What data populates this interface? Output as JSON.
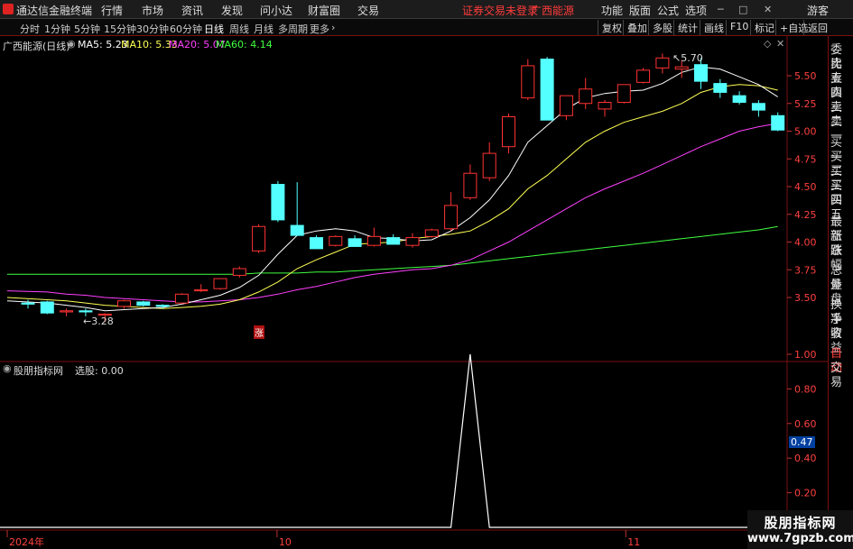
{
  "app": {
    "name": "通达信金融终端"
  },
  "menu": [
    "行情",
    "市场",
    "资讯",
    "发现",
    "问小达",
    "财富圈",
    "交易"
  ],
  "status_text": "证券交易未登录",
  "stock_name": "广西能源",
  "right_menu": [
    "功能",
    "版面",
    "公式",
    "选项"
  ],
  "window_buttons": [
    "─",
    "□",
    "✕"
  ],
  "user": "游客",
  "periods": [
    "分时",
    "1分钟",
    "5分钟",
    "15分钟",
    "30分钟",
    "60分钟",
    "日线",
    "周线",
    "月线",
    "多周期",
    "更多"
  ],
  "active_period": "日线",
  "toolbar": [
    "复权",
    "叠加",
    "多股",
    "统计",
    "画线",
    "F10",
    "标记",
    "+自选",
    "返回"
  ],
  "main_header": {
    "title": "广西能源(日线)"
  },
  "ma_legend": [
    {
      "label": "MA5: 5.23",
      "color": "#ffffff"
    },
    {
      "label": "MA10: 5.33",
      "color": "#ffff55"
    },
    {
      "label": "MA20: 5.07",
      "color": "#ff40ff"
    },
    {
      "label": "MA60: 4.14",
      "color": "#40ff40"
    }
  ],
  "price_axis": [
    "5.50",
    "5.25",
    "5.00",
    "4.75",
    "4.50",
    "4.25",
    "4.00",
    "3.75",
    "3.50"
  ],
  "annotations": {
    "high": "5.70",
    "low": "3.28",
    "limit_up": "涨"
  },
  "sub_header": {
    "title": "股朋指标网",
    "value_label": "选股: 0.00"
  },
  "sub_axis": [
    "1.00",
    "0.80",
    "0.60",
    "0.40",
    "0.20"
  ],
  "sub_current": "0.47",
  "date_axis": [
    "2024年",
    "10",
    "11"
  ],
  "right_panel": [
    "委比",
    "卖五",
    "卖四",
    "卖三",
    "卖二",
    "卖一",
    "买一",
    "买二",
    "买三",
    "买四",
    "买五",
    "最新",
    "涨跌",
    "涨幅",
    "总量",
    "外盘",
    "换手",
    "净资",
    "收益",
    "自动",
    "交易"
  ],
  "watermark": {
    "line1": "股朋指标网",
    "line2": "www.7gpzb.com"
  },
  "colors": {
    "up": "#ff3232",
    "down": "#54ffff",
    "background": "#000000",
    "grid": "#7a1010"
  },
  "chart_data": {
    "type": "candlestick",
    "y_range": [
      3.3,
      5.75
    ],
    "candles": [
      {
        "o": 3.45,
        "h": 3.48,
        "l": 3.4,
        "c": 3.44
      },
      {
        "o": 3.46,
        "h": 3.47,
        "l": 3.35,
        "c": 3.36
      },
      {
        "o": 3.37,
        "h": 3.4,
        "l": 3.33,
        "c": 3.38
      },
      {
        "o": 3.38,
        "h": 3.4,
        "l": 3.33,
        "c": 3.37
      },
      {
        "o": 3.34,
        "h": 3.36,
        "l": 3.28,
        "c": 3.35
      },
      {
        "o": 3.42,
        "h": 3.48,
        "l": 3.4,
        "c": 3.47
      },
      {
        "o": 3.46,
        "h": 3.47,
        "l": 3.42,
        "c": 3.43
      },
      {
        "o": 3.43,
        "h": 3.44,
        "l": 3.4,
        "c": 3.42
      },
      {
        "o": 3.45,
        "h": 3.54,
        "l": 3.44,
        "c": 3.53
      },
      {
        "o": 3.56,
        "h": 3.62,
        "l": 3.55,
        "c": 3.57
      },
      {
        "o": 3.58,
        "h": 3.64,
        "l": 3.57,
        "c": 3.67
      },
      {
        "o": 3.7,
        "h": 3.78,
        "l": 3.68,
        "c": 3.76
      },
      {
        "o": 3.92,
        "h": 4.16,
        "l": 3.9,
        "c": 4.14
      },
      {
        "o": 4.52,
        "h": 4.55,
        "l": 4.18,
        "c": 4.2
      },
      {
        "o": 4.15,
        "h": 4.54,
        "l": 4.06,
        "c": 4.06
      },
      {
        "o": 4.04,
        "h": 4.06,
        "l": 3.98,
        "c": 3.94
      },
      {
        "o": 3.97,
        "h": 4.06,
        "l": 3.96,
        "c": 4.05
      },
      {
        "o": 4.03,
        "h": 4.06,
        "l": 3.97,
        "c": 3.96
      },
      {
        "o": 3.97,
        "h": 4.13,
        "l": 3.96,
        "c": 4.05
      },
      {
        "o": 4.04,
        "h": 4.07,
        "l": 3.99,
        "c": 3.98
      },
      {
        "o": 3.97,
        "h": 4.08,
        "l": 3.95,
        "c": 4.04
      },
      {
        "o": 4.05,
        "h": 4.12,
        "l": 4.04,
        "c": 4.11
      },
      {
        "o": 4.12,
        "h": 4.45,
        "l": 4.1,
        "c": 4.33
      },
      {
        "o": 4.4,
        "h": 4.7,
        "l": 4.38,
        "c": 4.62
      },
      {
        "o": 4.58,
        "h": 4.9,
        "l": 4.55,
        "c": 4.8
      },
      {
        "o": 4.86,
        "h": 5.16,
        "l": 4.8,
        "c": 5.13
      },
      {
        "o": 5.3,
        "h": 5.65,
        "l": 5.28,
        "c": 5.59
      },
      {
        "o": 5.65,
        "h": 5.67,
        "l": 5.1,
        "c": 5.1
      },
      {
        "o": 5.14,
        "h": 5.3,
        "l": 5.1,
        "c": 5.32
      },
      {
        "o": 5.25,
        "h": 5.48,
        "l": 5.2,
        "c": 5.38
      },
      {
        "o": 5.2,
        "h": 5.28,
        "l": 5.13,
        "c": 5.26
      },
      {
        "o": 5.26,
        "h": 5.42,
        "l": 5.25,
        "c": 5.42
      },
      {
        "o": 5.44,
        "h": 5.57,
        "l": 5.43,
        "c": 5.55
      },
      {
        "o": 5.57,
        "h": 5.7,
        "l": 5.52,
        "c": 5.66
      },
      {
        "o": 5.56,
        "h": 5.64,
        "l": 5.48,
        "c": 5.58
      },
      {
        "o": 5.6,
        "h": 5.66,
        "l": 5.38,
        "c": 5.45
      },
      {
        "o": 5.43,
        "h": 5.47,
        "l": 5.3,
        "c": 5.35
      },
      {
        "o": 5.32,
        "h": 5.36,
        "l": 5.24,
        "c": 5.26
      },
      {
        "o": 5.25,
        "h": 5.28,
        "l": 5.13,
        "c": 5.19
      },
      {
        "o": 5.14,
        "h": 5.17,
        "l": 5.0,
        "c": 5.01
      }
    ],
    "ma5": [
      3.47,
      3.45,
      3.43,
      3.41,
      3.38,
      3.39,
      3.4,
      3.41,
      3.44,
      3.48,
      3.52,
      3.59,
      3.7,
      3.89,
      4.06,
      4.1,
      4.12,
      4.1,
      4.04,
      4.03,
      4.01,
      4.02,
      4.1,
      4.22,
      4.38,
      4.6,
      4.9,
      5.05,
      5.2,
      5.3,
      5.34,
      5.36,
      5.37,
      5.43,
      5.53,
      5.58,
      5.56,
      5.49,
      5.42,
      5.31
    ],
    "ma10": [
      3.5,
      3.48,
      3.47,
      3.45,
      3.43,
      3.42,
      3.41,
      3.4,
      3.41,
      3.42,
      3.44,
      3.48,
      3.55,
      3.64,
      3.76,
      3.84,
      3.91,
      3.98,
      3.99,
      4.0,
      4.03,
      4.05,
      4.07,
      4.1,
      4.19,
      4.3,
      4.48,
      4.6,
      4.75,
      4.9,
      5.0,
      5.08,
      5.13,
      5.18,
      5.25,
      5.35,
      5.4,
      5.42,
      5.41,
      5.37
    ],
    "ma20": [
      3.56,
      3.55,
      3.53,
      3.52,
      3.5,
      3.49,
      3.48,
      3.47,
      3.46,
      3.46,
      3.47,
      3.48,
      3.5,
      3.53,
      3.57,
      3.6,
      3.64,
      3.68,
      3.71,
      3.73,
      3.75,
      3.76,
      3.79,
      3.84,
      3.92,
      4.0,
      4.1,
      4.2,
      4.3,
      4.4,
      4.48,
      4.55,
      4.62,
      4.7,
      4.78,
      4.86,
      4.93,
      5.0,
      5.04,
      5.07
    ],
    "ma60": [
      3.71,
      3.71,
      3.71,
      3.71,
      3.71,
      3.71,
      3.71,
      3.71,
      3.71,
      3.71,
      3.71,
      3.71,
      3.72,
      3.72,
      3.72,
      3.73,
      3.73,
      3.74,
      3.75,
      3.76,
      3.77,
      3.78,
      3.79,
      3.81,
      3.83,
      3.85,
      3.87,
      3.89,
      3.91,
      3.93,
      3.95,
      3.97,
      3.99,
      4.01,
      4.03,
      4.05,
      4.07,
      4.09,
      4.11,
      4.14
    ],
    "indicator": {
      "name": "选股",
      "values": [
        0,
        0,
        0,
        0,
        0,
        0,
        0,
        0,
        0,
        0,
        0,
        0,
        0,
        0,
        0,
        0,
        0,
        0,
        0,
        0,
        0,
        0,
        0,
        1,
        0,
        0,
        0,
        0,
        0,
        0,
        0,
        0,
        0,
        0,
        0,
        0,
        0,
        0,
        0,
        0
      ]
    }
  }
}
